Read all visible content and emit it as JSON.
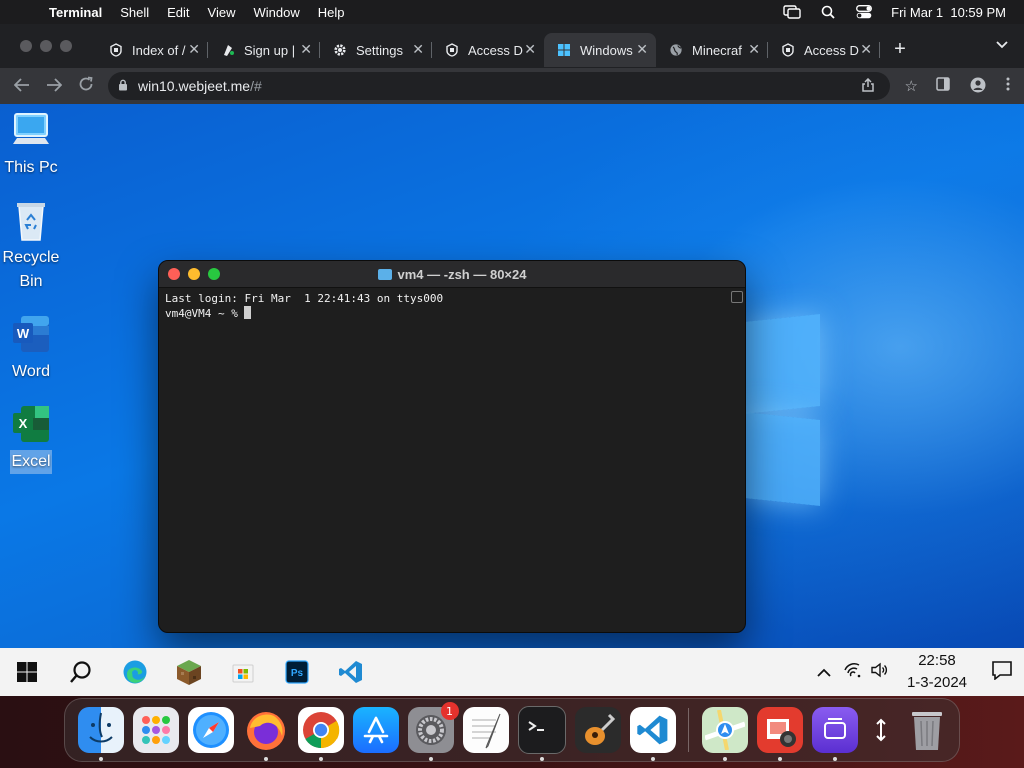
{
  "menubar": {
    "app_name": "Terminal",
    "menus": [
      "Shell",
      "Edit",
      "View",
      "Window",
      "Help"
    ],
    "clock": "Fri Mar 1  10:59 PM"
  },
  "browser": {
    "tabs": [
      {
        "title": "Index of /",
        "icon": "access-icon"
      },
      {
        "title": "Sign up | ",
        "icon": "signup-icon"
      },
      {
        "title": "Settings",
        "icon": "gear-icon"
      },
      {
        "title": "Access D",
        "icon": "access-icon"
      },
      {
        "title": "Windows",
        "icon": "windows-icon",
        "active": true
      },
      {
        "title": "Minecraf",
        "icon": "globe-icon"
      },
      {
        "title": "Access D",
        "icon": "access-icon"
      }
    ],
    "url_host": "win10.webjeet.me",
    "url_rest": "/#"
  },
  "desktop": {
    "icons": [
      {
        "label": "This Pc"
      },
      {
        "label": "Recycle Bin"
      },
      {
        "label": "Word"
      },
      {
        "label": "Excel",
        "selected": true
      }
    ]
  },
  "terminal": {
    "title": "vm4 — -zsh — 80×24",
    "lines": [
      "Last login: Fri Mar  1 22:41:43 on ttys000",
      "vm4@VM4 ~ % "
    ]
  },
  "taskbar": {
    "time": "22:58",
    "date": "1-3-2024"
  },
  "dock": {
    "apps": [
      "Finder",
      "Launchpad",
      "Safari",
      "Firefox",
      "Chrome",
      "App Store",
      "System Settings",
      "TextEdit",
      "Terminal",
      "GarageBand",
      "VS Code",
      "Maps",
      "Photo Booth",
      "Simulator",
      "Trash"
    ],
    "settings_badge": "1"
  },
  "colors": {
    "desktop_blue": "#0a78e6",
    "terminal_bg": "#1e1e1e",
    "close_light": "#fe5f57",
    "minimize_light": "#febc2e",
    "zoom_light": "#28c840"
  }
}
